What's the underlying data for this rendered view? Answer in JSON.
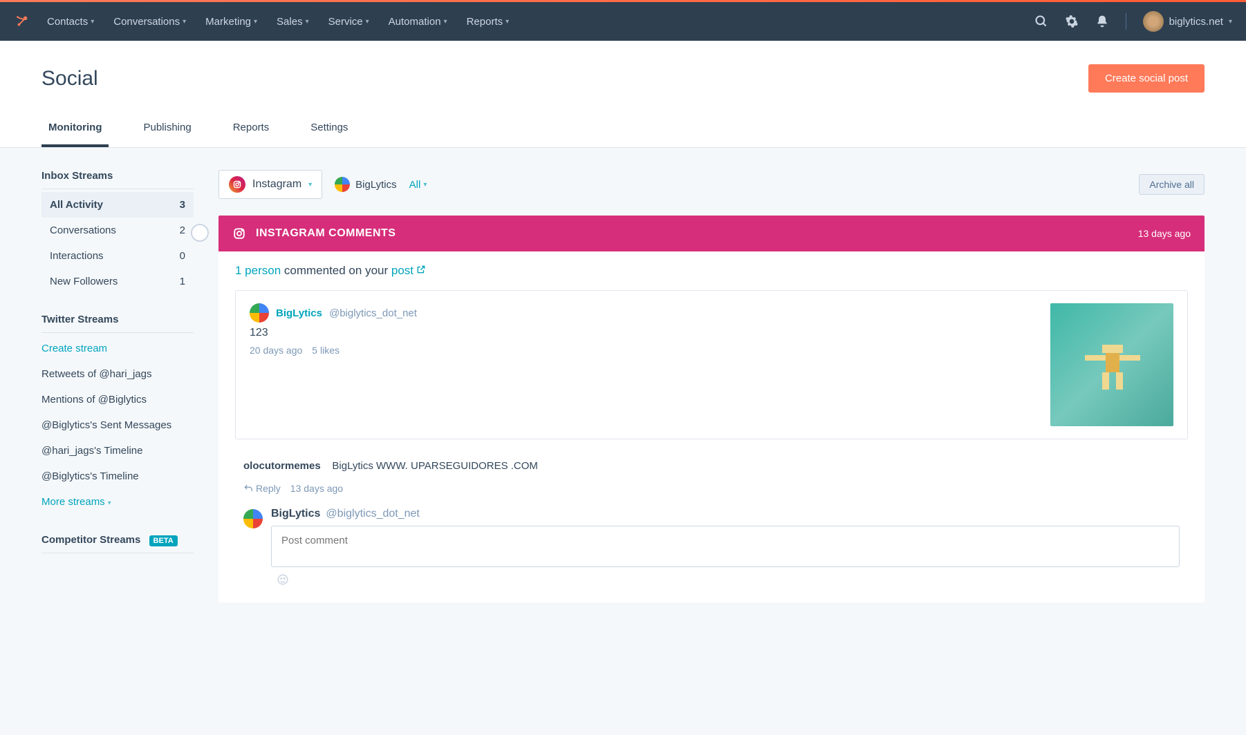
{
  "nav": {
    "items": [
      "Contacts",
      "Conversations",
      "Marketing",
      "Sales",
      "Service",
      "Automation",
      "Reports"
    ],
    "account": "biglytics.net"
  },
  "page": {
    "title": "Social",
    "cta": "Create social post"
  },
  "tabs": [
    "Monitoring",
    "Publishing",
    "Reports",
    "Settings"
  ],
  "sidebar": {
    "inbox_title": "Inbox Streams",
    "inbox_items": [
      {
        "label": "All Activity",
        "count": "3"
      },
      {
        "label": "Conversations",
        "count": "2"
      },
      {
        "label": "Interactions",
        "count": "0"
      },
      {
        "label": "New Followers",
        "count": "1"
      }
    ],
    "twitter_title": "Twitter Streams",
    "create_stream": "Create stream",
    "twitter_items": [
      "Retweets of @hari_jags",
      "Mentions of @Biglytics",
      "@Biglytics's Sent Messages",
      "@hari_jags's Timeline",
      "@Biglytics's Timeline"
    ],
    "more_streams": "More streams",
    "competitor_title": "Competitor Streams",
    "beta": "BETA"
  },
  "filters": {
    "platform": "Instagram",
    "account": "BigLytics",
    "scope": "All",
    "archive": "Archive all"
  },
  "card": {
    "header": "INSTAGRAM COMMENTS",
    "timestamp": "13 days ago",
    "summary_count": "1 person",
    "summary_mid": " commented on your ",
    "summary_link": "post",
    "post": {
      "author": "BigLytics",
      "handle": "@biglytics_dot_net",
      "body": "123",
      "age": "20 days ago",
      "likes": "5 likes"
    },
    "comment": {
      "author": "olocutormemes",
      "text": "BigLytics WWW. UPARSEGUIDORES .COM",
      "reply": "Reply",
      "age": "13 days ago"
    },
    "reply_box": {
      "author": "BigLytics",
      "handle": "@biglytics_dot_net",
      "placeholder": "Post comment"
    }
  }
}
